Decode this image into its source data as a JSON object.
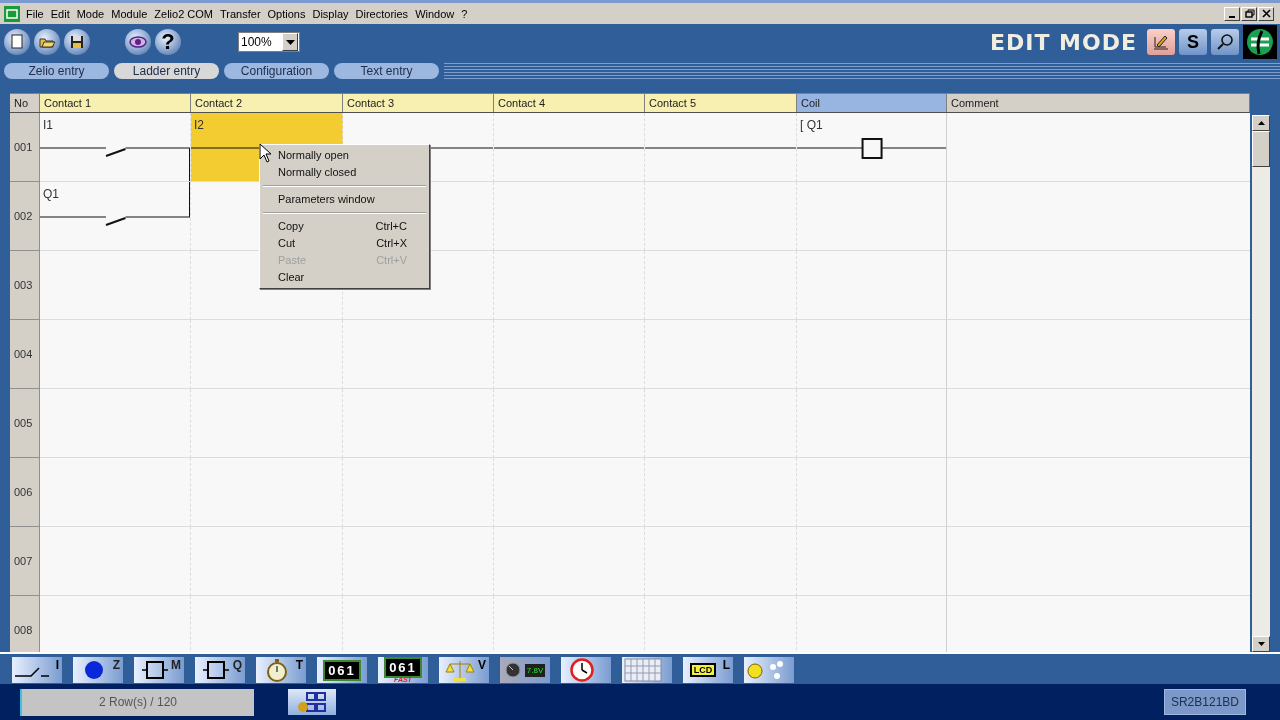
{
  "menu": [
    "File",
    "Edit",
    "Mode",
    "Module",
    "Zelio2 COM",
    "Transfer",
    "Options",
    "Display",
    "Directories",
    "Window",
    "?"
  ],
  "toolbar": {
    "buttons": [
      {
        "kind": "new"
      },
      {
        "kind": "open"
      },
      {
        "kind": "save"
      },
      {
        "kind": "view"
      },
      {
        "kind": "help",
        "label": "?"
      }
    ],
    "zoom": "100%",
    "mode": "EDIT MODE",
    "right_buttons": [
      {
        "kind": "edit"
      },
      {
        "kind": "letter",
        "label": "S"
      },
      {
        "kind": "search"
      },
      {
        "kind": "logo"
      }
    ]
  },
  "tabs": [
    {
      "label": "Zelio entry",
      "selected": false
    },
    {
      "label": "Ladder entry",
      "selected": true
    },
    {
      "label": "Configuration",
      "selected": false
    },
    {
      "label": "Text entry",
      "selected": false
    }
  ],
  "grid": {
    "columns": [
      {
        "label": "No",
        "kind": "number"
      },
      {
        "label": "Contact 1",
        "kind": "contact"
      },
      {
        "label": "Contact 2",
        "kind": "contact"
      },
      {
        "label": "Contact 3",
        "kind": "contact"
      },
      {
        "label": "Contact 4",
        "kind": "contact"
      },
      {
        "label": "Contact 5",
        "kind": "contact"
      },
      {
        "label": "Coil",
        "kind": "coil"
      },
      {
        "label": "Comment",
        "kind": "comment"
      }
    ],
    "rows": [
      {
        "number": "001",
        "cells": [
          {
            "kind": "contact",
            "label": "I1",
            "selected": false
          },
          {
            "kind": "wire",
            "label": "I2",
            "selected": true
          },
          {
            "kind": "wire",
            "selected": false
          },
          {
            "kind": "wire",
            "selected": false
          },
          {
            "kind": "wire",
            "selected": false
          },
          {
            "kind": "coil",
            "label": "[ Q1",
            "selected": false
          },
          {
            "kind": "empty",
            "selected": false
          }
        ]
      },
      {
        "number": "002",
        "cells": [
          {
            "kind": "contact",
            "label": "Q1",
            "branch_up": true,
            "selected": false
          },
          {
            "kind": "empty",
            "selected": false
          },
          {
            "kind": "empty",
            "selected": false
          },
          {
            "kind": "empty",
            "selected": false
          },
          {
            "kind": "empty",
            "selected": false
          },
          {
            "kind": "empty",
            "selected": false
          },
          {
            "kind": "empty",
            "selected": false
          }
        ]
      },
      {
        "number": "003"
      },
      {
        "number": "004"
      },
      {
        "number": "005"
      },
      {
        "number": "006"
      },
      {
        "number": "007"
      },
      {
        "number": "008"
      }
    ]
  },
  "context_menu": [
    {
      "kind": "item",
      "label": "Normally open",
      "disabled": false
    },
    {
      "kind": "item",
      "label": "Normally closed",
      "disabled": false
    },
    {
      "kind": "separator"
    },
    {
      "kind": "item",
      "label": "Parameters window",
      "disabled": false
    },
    {
      "kind": "separator"
    },
    {
      "kind": "item",
      "label": "Copy",
      "shortcut": "Ctrl+C",
      "disabled": false
    },
    {
      "kind": "item",
      "label": "Cut",
      "shortcut": "Ctrl+X",
      "disabled": false
    },
    {
      "kind": "item",
      "label": "Paste",
      "shortcut": "Ctrl+V",
      "disabled": true
    },
    {
      "kind": "item",
      "label": "Clear",
      "disabled": false
    }
  ],
  "palette": [
    {
      "kind": "contact",
      "letter": "I"
    },
    {
      "kind": "dot",
      "letter": "Z"
    },
    {
      "kind": "relay",
      "letter": "M"
    },
    {
      "kind": "relay",
      "letter": "Q"
    },
    {
      "kind": "timer",
      "letter": "T"
    },
    {
      "kind": "counter",
      "display": "061"
    },
    {
      "kind": "fast_counter",
      "display": "061",
      "sub": "FAST"
    },
    {
      "kind": "compare",
      "letter": "V"
    },
    {
      "kind": "analog",
      "display": "7.8V"
    },
    {
      "kind": "clock"
    },
    {
      "kind": "keypad"
    },
    {
      "kind": "lcd",
      "display": "LCD",
      "letter": "L"
    },
    {
      "kind": "sun"
    }
  ],
  "status_bar": {
    "rows": "2 Row(s) / 120",
    "module": "SR2B121BD"
  }
}
